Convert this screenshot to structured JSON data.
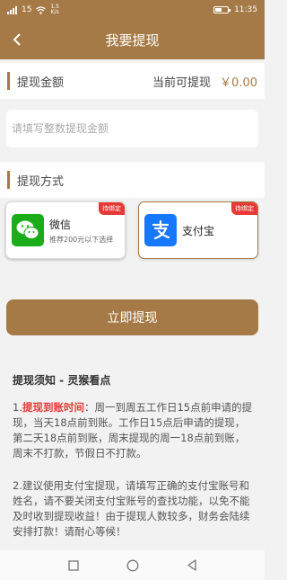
{
  "status": {
    "signal_text": "15",
    "speed_value": "1.5",
    "speed_unit": "K/s",
    "battery_level": "0.55",
    "battery_text": "",
    "time": "11:35"
  },
  "nav": {
    "title": "我要提现"
  },
  "amount": {
    "label": "提现金额",
    "balance_label": "当前可提现",
    "balance_value": "￥0.00",
    "placeholder": "请填写整数提现金额"
  },
  "method": {
    "label": "提现方式",
    "wechat": {
      "name": "微信",
      "sub": "推荐200元以下选择",
      "badge": "待绑定"
    },
    "alipay": {
      "name": "支付宝",
      "badge": "待绑定"
    }
  },
  "submit": {
    "label": "立即提现"
  },
  "notice": {
    "title": "提现须知 - 灵猴看点",
    "p1_prefix": "1.",
    "p1_highlight": "提现到账时间",
    "p1_body": "：周一到周五工作日15点前申请的提现，当天18点前到账。工作日15点后申请的提现，第二天18点前到账，周末提现的周一18点前到账，周末不打款，节假日不打款。",
    "p2": "2.建议使用支付宝提现，请填写正确的支付宝账号和姓名，请不要关闭支付宝账号的查找功能，以免不能及时收到提现收益！由于提现人数较多，财务会陆续安排打款！请耐心等候！"
  },
  "colors": {
    "brand": "#a57a47",
    "badge_red": "#e53935",
    "wechat_green": "#1aad19",
    "alipay_blue": "#1677ff"
  }
}
